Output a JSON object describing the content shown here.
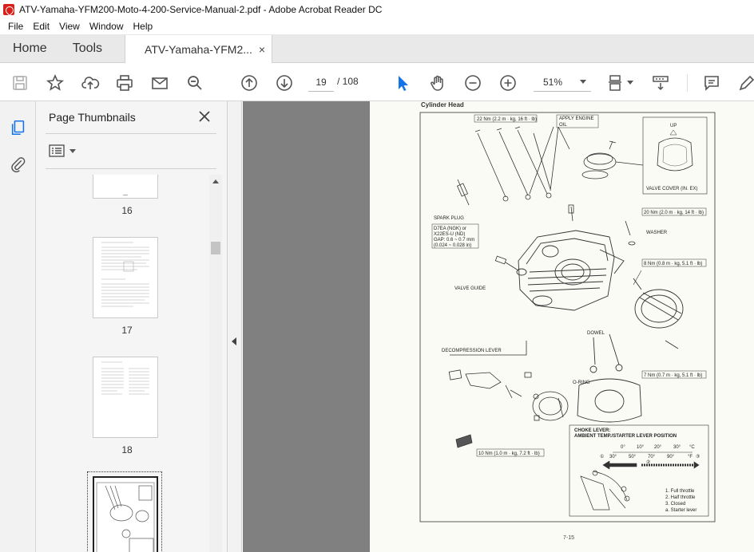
{
  "window": {
    "title": "ATV-Yamaha-YFM200-Moto-4-200-Service-Manual-2.pdf - Adobe Acrobat Reader DC"
  },
  "menu": [
    "File",
    "Edit",
    "View",
    "Window",
    "Help"
  ],
  "tabs": {
    "home": "Home",
    "tools": "Tools",
    "document": "ATV-Yamaha-YFM2...",
    "close_glyph": "×"
  },
  "toolbar": {
    "current_page": "19",
    "page_total": "/ 108",
    "zoom": "51%"
  },
  "thumbnails": {
    "panel_title": "Page Thumbnails",
    "items": [
      {
        "label": "16"
      },
      {
        "label": "17"
      },
      {
        "label": "18"
      },
      {
        "label": ""
      }
    ]
  },
  "page": {
    "title": "Cylinder Head",
    "page_number": "7-15",
    "callouts": {
      "torque_top": "22 Nm (2.2 m · kg, 16 ft · lb)",
      "apply_oil_1": "APPLY ENGINE",
      "apply_oil_2": "OIL",
      "up": "UP",
      "valve_cover": "VALVE COVER (IN. EX)",
      "torque_20": "20 Nm (2.0 m · kg, 14 ft · lb)",
      "washer": "WASHER",
      "spark_plug": "SPARK PLUG",
      "spark_spec_1": "D7EA (NGK) or",
      "spark_spec_2": "X22ES-U (ND)",
      "spark_spec_3": "GAP: 0.6 ~ 0.7 mm",
      "spark_spec_4": "(0.024 ~ 0.028 in)",
      "torque_8": "8 Nm (0.8 m · kg, 5.1 ft · lb)",
      "valve_guide": "VALVE GUIDE",
      "dowel": "DOWEL",
      "decompression": "DECOMPRESSION LEVER",
      "o_ring": "O-RING",
      "torque_7": "7 Nm (0.7 m · kg, 5.1 ft · lb)",
      "choke_1": "CHOKE LEVER:",
      "choke_2": "AMBIENT TEMP./STARTER LEVER POSITION",
      "torque_10": "10 Nm (1.0 m · kg, 7.2 ft · lb)",
      "temp_c": [
        "0°",
        "10°",
        "20°",
        "30°",
        "°C"
      ],
      "temp_f": [
        "30°",
        "50°",
        "70°",
        "90°",
        "°F"
      ],
      "legend": [
        "1.  Full throttle",
        "2.  Half throttle",
        "3.  Closed",
        "a.  Starter lever"
      ],
      "marker_1": "①",
      "marker_2": "②",
      "marker_3": "③"
    }
  },
  "colors": {
    "accent": "#1473e6",
    "doc_bg": "#808080"
  }
}
